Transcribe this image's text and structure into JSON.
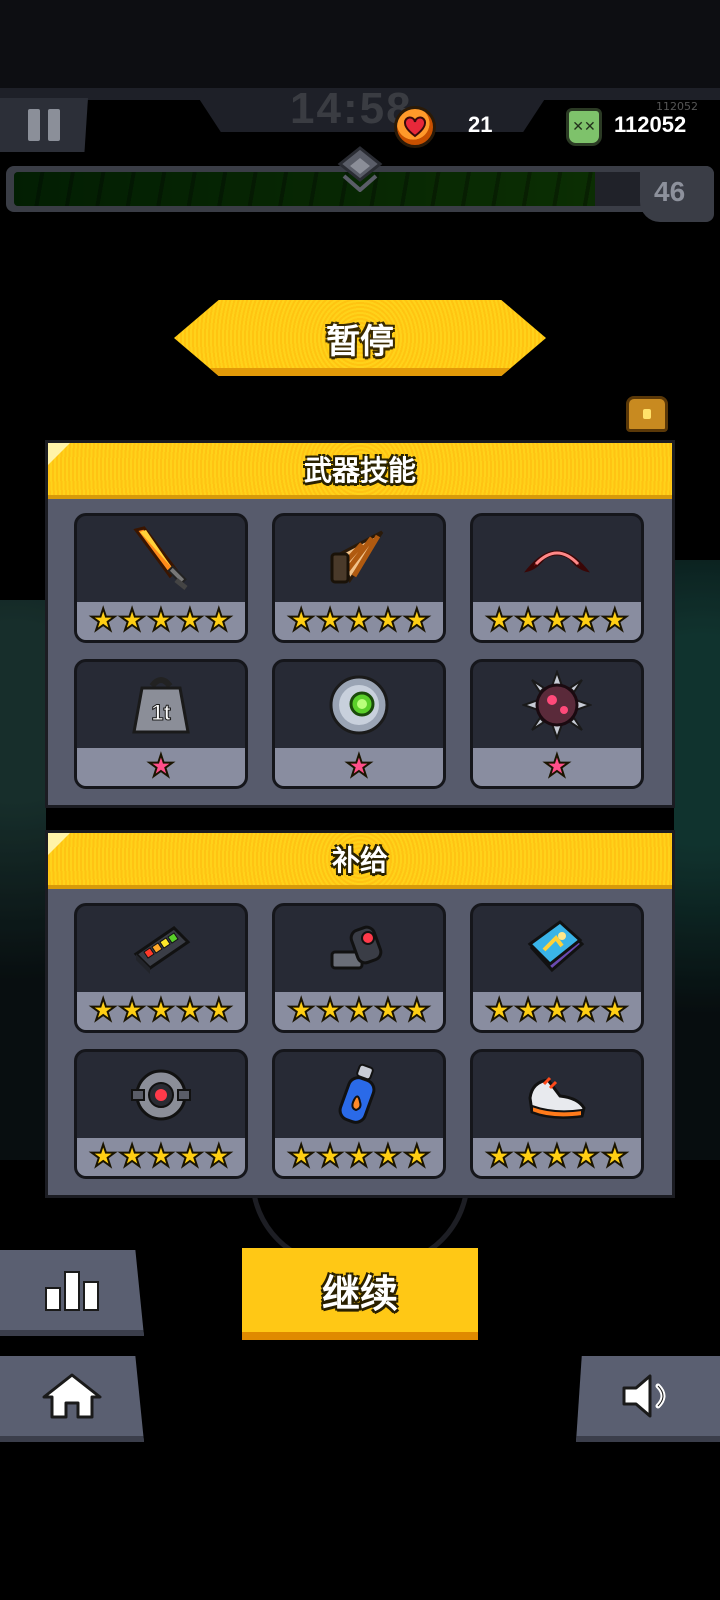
{
  "hud": {
    "timer": "14:58",
    "lives": "21",
    "kills": "112052",
    "kills_ghost": "112052",
    "level": "46",
    "xp_fraction": 0.92,
    "icons": {
      "pause": "pause-icon",
      "lives": "heart-icon",
      "kills": "skull-icon",
      "chest": "chest-icon"
    }
  },
  "title": "暂停",
  "weapons": {
    "title": "武器技能",
    "items": [
      {
        "icon": "flame-sword-icon",
        "stars": 5,
        "star_color": "#ffcf14"
      },
      {
        "icon": "drill-icon",
        "stars": 5,
        "star_color": "#ffcf14"
      },
      {
        "icon": "boomerang-icon",
        "stars": 5,
        "star_color": "#ffcf14"
      },
      {
        "icon": "weight-1t-icon",
        "weight_label": "1t",
        "stars": 1,
        "star_color": "#ff4f8a"
      },
      {
        "icon": "orb-icon",
        "stars": 1,
        "star_color": "#ff4f8a"
      },
      {
        "icon": "spiked-ball-icon",
        "stars": 1,
        "star_color": "#ff4f8a"
      }
    ]
  },
  "supplies": {
    "title": "补给",
    "items": [
      {
        "icon": "battery-icon",
        "stars": 5,
        "star_color": "#ffcf14"
      },
      {
        "icon": "arm-cannon-icon",
        "stars": 5,
        "star_color": "#ffcf14"
      },
      {
        "icon": "book-icon",
        "stars": 5,
        "star_color": "#ffcf14"
      },
      {
        "icon": "drone-core-icon",
        "stars": 5,
        "star_color": "#ffcf14"
      },
      {
        "icon": "fuel-canister-icon",
        "stars": 5,
        "star_color": "#ffcf14"
      },
      {
        "icon": "sneaker-icon",
        "stars": 5,
        "star_color": "#ffcf14"
      }
    ]
  },
  "buttons": {
    "continue": "继续",
    "stats_icon": "bar-chart-icon",
    "home_icon": "home-icon",
    "sound_icon": "speaker-icon"
  }
}
